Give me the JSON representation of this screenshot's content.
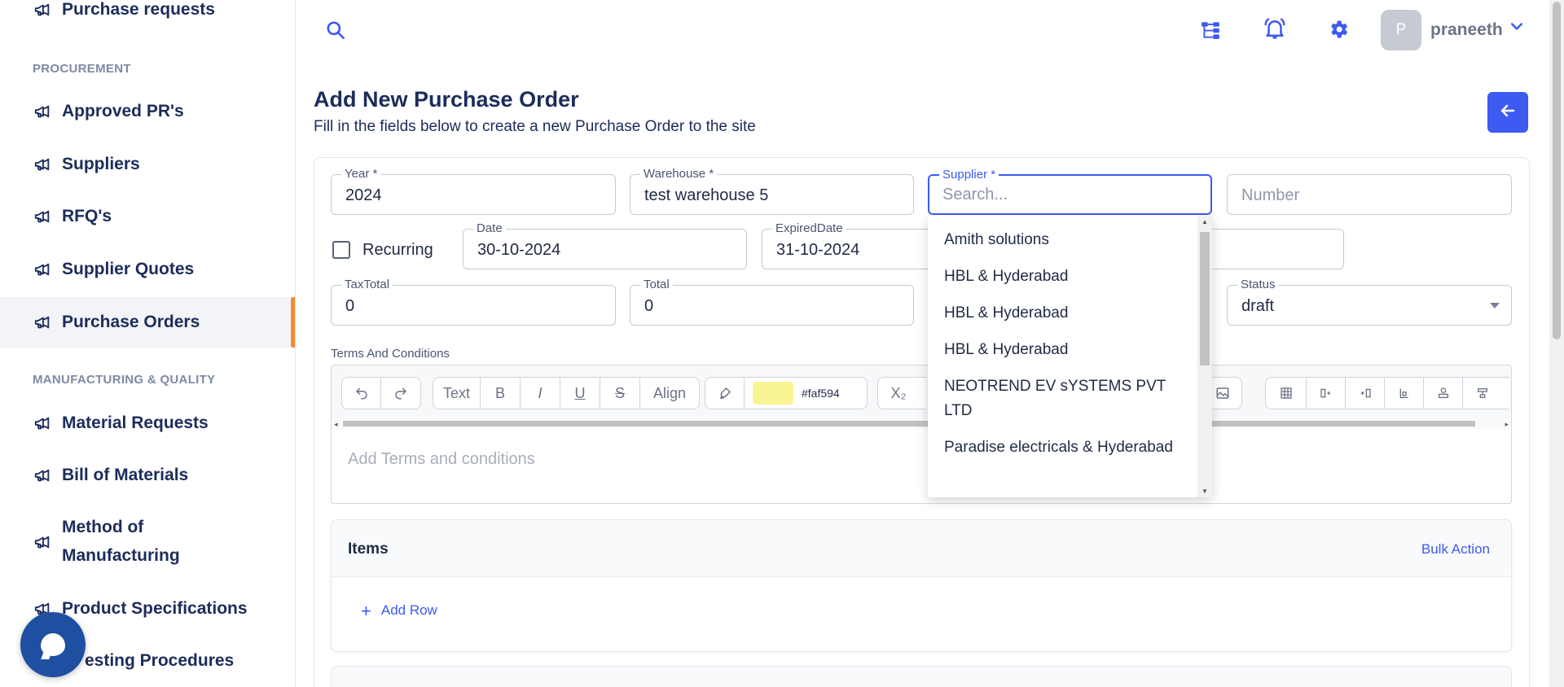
{
  "sidebar": {
    "items": [
      {
        "label": "Purchase requests"
      },
      {
        "label": "Approved PR's"
      },
      {
        "label": "Suppliers"
      },
      {
        "label": "RFQ's"
      },
      {
        "label": "Supplier Quotes"
      },
      {
        "label": "Purchase Orders",
        "active": true
      },
      {
        "label": "Material Requests"
      },
      {
        "label": "Bill of Materials"
      },
      {
        "label": "Method of Manufacturing"
      },
      {
        "label": "Product Specifications"
      },
      {
        "label": "Testing Procedures"
      }
    ],
    "sections": {
      "procurement": "PROCUREMENT",
      "manufacturing": "MANUFACTURING & QUALITY"
    },
    "method_line1": "Method of",
    "method_line2": "Manufacturing",
    "testing_visible": "esting Procedures"
  },
  "topbar": {
    "icons": [
      "search-icon",
      "sitemap-icon",
      "bell-icon",
      "gear-icon",
      "chevron-down-icon"
    ],
    "avatar_initial": "P",
    "username": "praneeth"
  },
  "header": {
    "title": "Add New Purchase Order",
    "subtitle": "Fill in the fields below to create a new Purchase Order to the site"
  },
  "form": {
    "year": {
      "label": "Year *",
      "value": "2024"
    },
    "warehouse": {
      "label": "Warehouse *",
      "value": "test warehouse 5"
    },
    "supplier": {
      "label": "Supplier *",
      "placeholder": "Search..."
    },
    "number": {
      "placeholder": "Number"
    },
    "recurring": {
      "label": "Recurring",
      "checked": false
    },
    "date": {
      "label": "Date",
      "value": "30-10-2024"
    },
    "expired_date": {
      "label": "ExpiredDate",
      "value": "31-10-2024"
    },
    "tax_total": {
      "label": "TaxTotal",
      "value": "0"
    },
    "total": {
      "label": "Total",
      "value": "0"
    },
    "status": {
      "label": "Status",
      "value": "draft"
    },
    "terms_label": "Terms And Conditions",
    "terms_placeholder": "Add Terms and conditions"
  },
  "editor_toolbar": {
    "text_label": "Text",
    "bold": "B",
    "italic": "I",
    "underline": "U",
    "strike": "S",
    "align_label": "Align",
    "highlight_color": "#faf594",
    "highlight_code": "#faf594",
    "subscript": "X₂"
  },
  "supplier_options": [
    "Amith solutions",
    "HBL & Hyderabad",
    "HBL & Hyderabad",
    "HBL & Hyderabad",
    "NEOTREND EV sYSTEMS PVT LTD",
    "Paradise electricals & Hyderabad"
  ],
  "items_section": {
    "title": "Items",
    "bulk_action": "Bulk Action",
    "add_row": "Add Row"
  },
  "colors": {
    "accent": "#3d5af1",
    "active_indicator": "#f28b2c",
    "nav_text": "#1c2c5b"
  }
}
